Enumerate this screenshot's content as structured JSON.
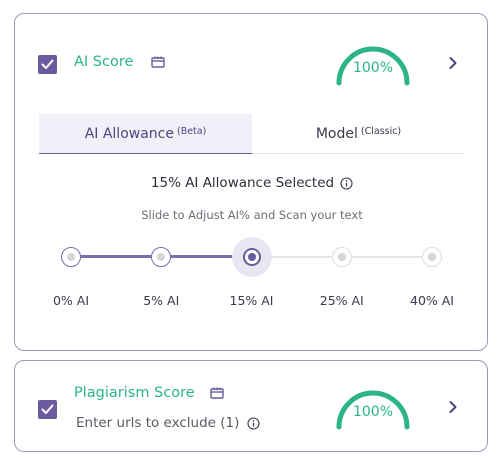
{
  "ai_card": {
    "title": "AI Score",
    "checked": true,
    "gauge_value": "100%",
    "tabs": [
      {
        "label": "AI Allowance",
        "sup": "(Beta)",
        "active": true
      },
      {
        "label": "Model",
        "sup": "(Classic)",
        "active": false
      }
    ],
    "selected_title": "15% AI Allowance Selected",
    "hint": "Slide to Adjust AI% and Scan your text",
    "slider": {
      "stops": [
        "0% AI",
        "5% AI",
        "15% AI",
        "25% AI",
        "40% AI"
      ],
      "selected_index": 2
    }
  },
  "plag_card": {
    "title": "Plagiarism Score",
    "checked": true,
    "exclude_text": "Enter urls to exclude (1)",
    "gauge_value": "100%"
  },
  "colors": {
    "accent_purple": "#6a5a9e",
    "accent_green": "#2bb585",
    "card_border": "#9e97be"
  },
  "icons": {
    "checkbox": "check-icon",
    "title_badge": "calendar-icon",
    "expand": "chevron-right-icon",
    "info": "info-icon"
  }
}
